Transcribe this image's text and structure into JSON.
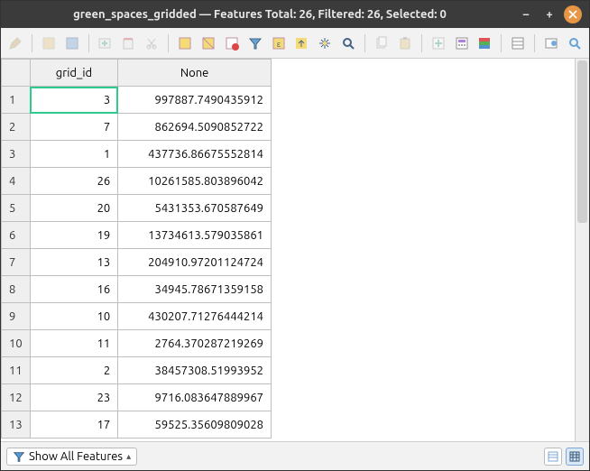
{
  "window": {
    "title": "green_spaces_gridded — Features Total: 26, Filtered: 26, Selected: 0"
  },
  "columns": {
    "col1": "grid_id",
    "col2": "None"
  },
  "rows": [
    {
      "n": "1",
      "grid_id": "3",
      "val": "997887.7490435912"
    },
    {
      "n": "2",
      "grid_id": "7",
      "val": "862694.5090852722"
    },
    {
      "n": "3",
      "grid_id": "1",
      "val": "437736.86675552814"
    },
    {
      "n": "4",
      "grid_id": "26",
      "val": "10261585.803896042"
    },
    {
      "n": "5",
      "grid_id": "20",
      "val": "5431353.670587649"
    },
    {
      "n": "6",
      "grid_id": "19",
      "val": "13734613.579035861"
    },
    {
      "n": "7",
      "grid_id": "13",
      "val": "204910.97201124724"
    },
    {
      "n": "8",
      "grid_id": "16",
      "val": "34945.78671359158"
    },
    {
      "n": "9",
      "grid_id": "10",
      "val": "430207.71276444214"
    },
    {
      "n": "10",
      "grid_id": "11",
      "val": "2764.370287219269"
    },
    {
      "n": "11",
      "grid_id": "2",
      "val": "38457308.51993952"
    },
    {
      "n": "12",
      "grid_id": "23",
      "val": "9716.083647889967"
    },
    {
      "n": "13",
      "grid_id": "17",
      "val": "59525.35609809028"
    }
  ],
  "statusbar": {
    "filter_label": "Show All Features"
  },
  "toolbar_icons": [
    "pencil-icon",
    "multiedit-icon",
    "save-edits-icon",
    "add-feature-icon",
    "delete-feature-icon",
    "cut-icon",
    "select-all-icon",
    "invert-select-icon",
    "deselect-icon",
    "filter-icon",
    "select-by-value-icon",
    "move-top-icon",
    "pan-icon",
    "zoom-icon",
    "copy-icon",
    "paste-icon",
    "new-field-icon",
    "field-calc-icon",
    "conditional-format-icon",
    "form-view-icon",
    "actions-icon",
    "dock-icon"
  ]
}
